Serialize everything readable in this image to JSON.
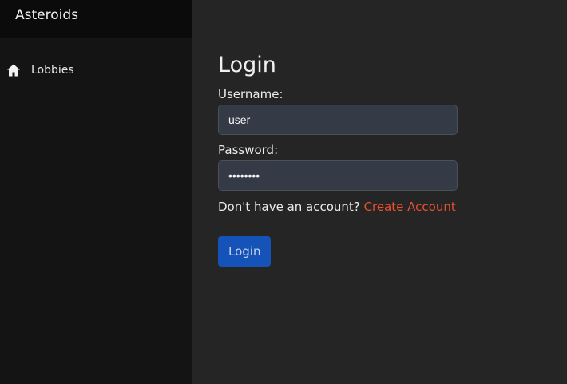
{
  "app": {
    "title": "Asteroids"
  },
  "sidebar": {
    "items": [
      {
        "label": "Lobbies",
        "icon": "home-icon"
      }
    ]
  },
  "login": {
    "heading": "Login",
    "username_label": "Username:",
    "username_value": "user",
    "password_label": "Password:",
    "password_value": "••••••••",
    "signup_prompt": "Don't have an account?",
    "signup_link": "Create Account",
    "submit_label": "Login"
  },
  "colors": {
    "sidebar_bg": "#141414",
    "brand_bg": "#0b0b0b",
    "main_bg": "#252525",
    "input_bg": "#343a46",
    "link": "#e8502f",
    "button_bg": "#1553b9"
  }
}
